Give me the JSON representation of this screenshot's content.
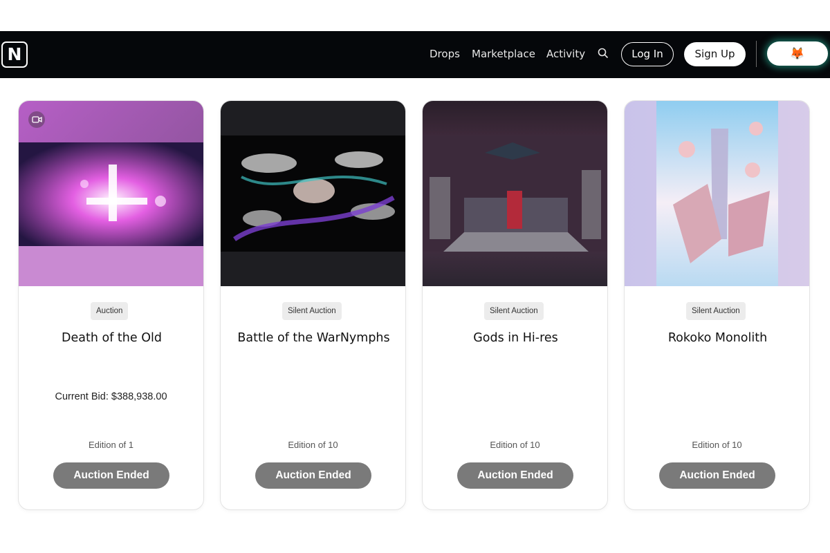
{
  "nav": {
    "logo": "N",
    "links": [
      "Drops",
      "Marketplace",
      "Activity"
    ],
    "search_icon": "search-icon",
    "login": "Log In",
    "signup": "Sign Up",
    "wallet_icon": "metamask-fox-icon",
    "wallet_glyph": "🦊"
  },
  "cards": [
    {
      "badge": "Auction",
      "title": "Death of the Old",
      "current_bid": "Current Bid: $388,938.00",
      "edition": "Edition of 1",
      "button": "Auction Ended",
      "has_video_icon": true
    },
    {
      "badge": "Silent Auction",
      "title": "Battle of the WarNymphs",
      "current_bid": "",
      "edition": "Edition of 10",
      "button": "Auction Ended"
    },
    {
      "badge": "Silent Auction",
      "title": "Gods in Hi-res",
      "current_bid": "",
      "edition": "Edition of 10",
      "button": "Auction Ended"
    },
    {
      "badge": "Silent Auction",
      "title": "Rokoko Monolith",
      "current_bid": "",
      "edition": "Edition of 10",
      "button": "Auction Ended"
    }
  ],
  "colors": {
    "navbar_bg": "#05070a",
    "button_disabled": "#7a7a7a",
    "badge_bg": "#ececec",
    "wallet_glow": "#28c8aa"
  }
}
